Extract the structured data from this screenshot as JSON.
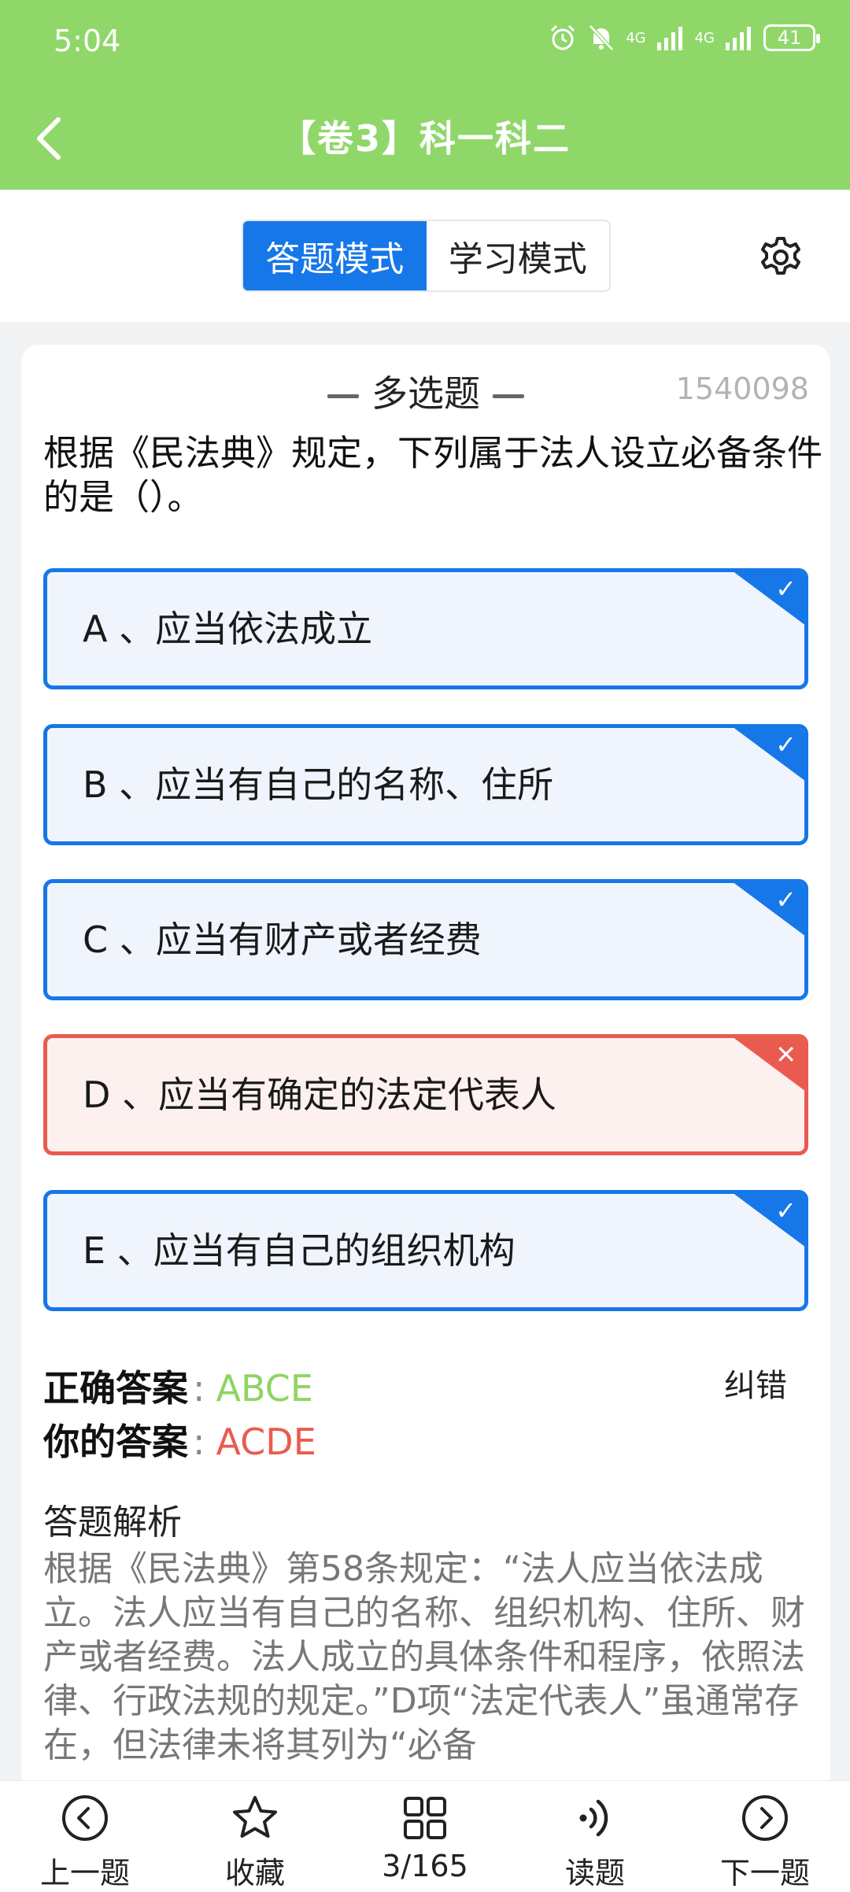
{
  "status_bar": {
    "time": "5:04",
    "signal1": "4G",
    "signal2": "4G",
    "battery": "41"
  },
  "header": {
    "title": "【卷3】科一科二"
  },
  "modes": {
    "answer_mode": "答题模式",
    "study_mode": "学习模式"
  },
  "question": {
    "type": "多选题",
    "id": "1540098",
    "text": "根据《民法典》规定，下列属于法人设立必备条件的是（）。",
    "options": [
      {
        "label": "A 、应当依法成立",
        "state": "correct",
        "mark": "✓"
      },
      {
        "label": "B 、应当有自己的名称、住所",
        "state": "correct",
        "mark": "✓"
      },
      {
        "label": "C 、应当有财产或者经费",
        "state": "correct",
        "mark": "✓"
      },
      {
        "label": "D 、应当有确定的法定代表人",
        "state": "wrong",
        "mark": "✕"
      },
      {
        "label": "E 、应当有自己的组织机构",
        "state": "correct",
        "mark": "✓"
      }
    ]
  },
  "answers": {
    "correct_label": "正确答案",
    "correct_value": "ABCE",
    "mine_label": "你的答案",
    "mine_value": "ACDE",
    "separator": ":",
    "report": "纠错"
  },
  "explanation": {
    "title": "答题解析",
    "text": "根据《民法典》第58条规定：“法人应当依法成立。法人应当有自己的名称、组织机构、住所、财产或者经费。法人成立的具体条件和程序，依照法律、行政法规的规定。”D项“法定代表人”虽通常存在，但法律未将其列为“必备"
  },
  "bottom_nav": {
    "prev": "上一题",
    "favorite": "收藏",
    "progress": "3/165",
    "read": "读题",
    "next": "下一题"
  },
  "colors": {
    "header_bg": "#90d76a",
    "accent_blue": "#1677e8",
    "wrong_red": "#ea5b4f",
    "correct_green": "#8fd461"
  }
}
